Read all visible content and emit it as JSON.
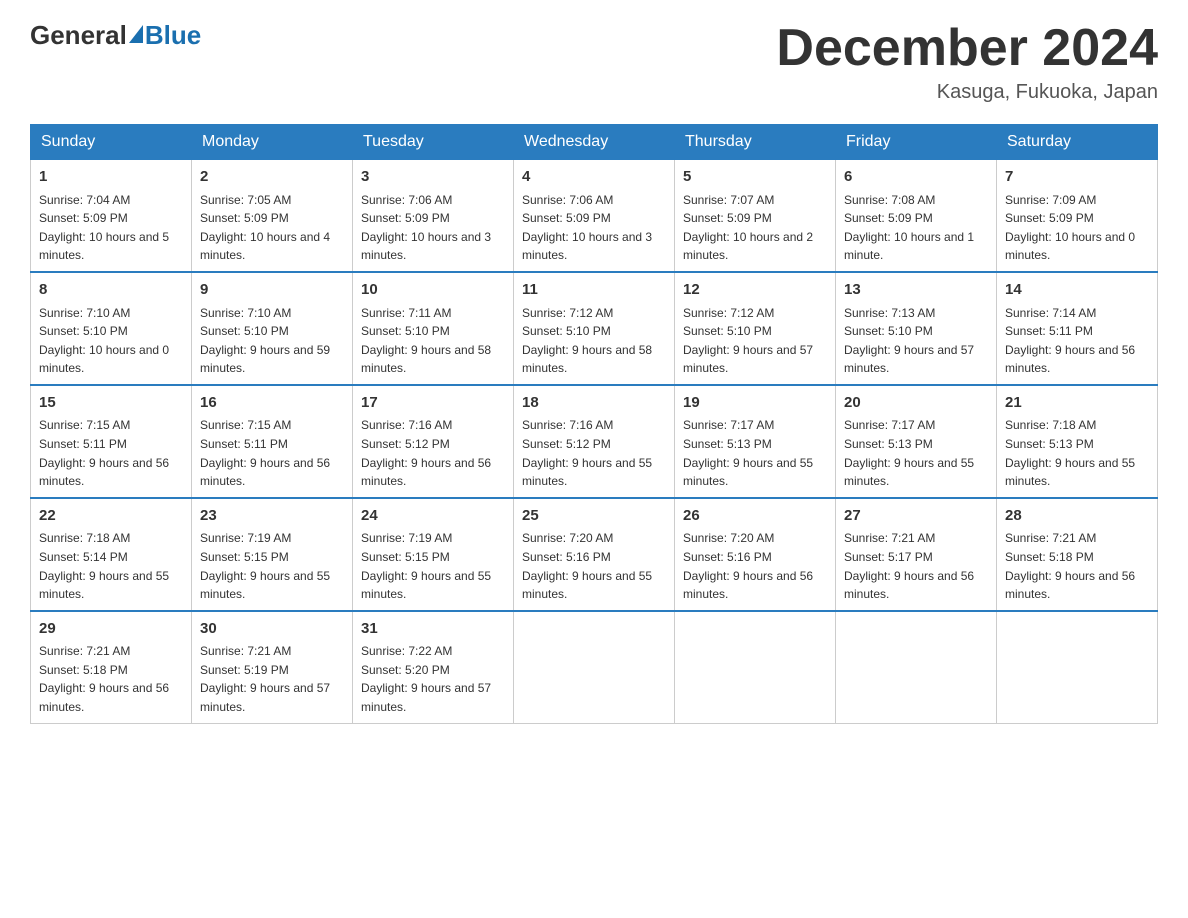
{
  "header": {
    "logo_general": "General",
    "logo_blue": "Blue",
    "month_title": "December 2024",
    "location": "Kasuga, Fukuoka, Japan"
  },
  "days_of_week": [
    "Sunday",
    "Monday",
    "Tuesday",
    "Wednesday",
    "Thursday",
    "Friday",
    "Saturday"
  ],
  "weeks": [
    [
      {
        "day": "1",
        "sunrise": "7:04 AM",
        "sunset": "5:09 PM",
        "daylight": "10 hours and 5 minutes."
      },
      {
        "day": "2",
        "sunrise": "7:05 AM",
        "sunset": "5:09 PM",
        "daylight": "10 hours and 4 minutes."
      },
      {
        "day": "3",
        "sunrise": "7:06 AM",
        "sunset": "5:09 PM",
        "daylight": "10 hours and 3 minutes."
      },
      {
        "day": "4",
        "sunrise": "7:06 AM",
        "sunset": "5:09 PM",
        "daylight": "10 hours and 3 minutes."
      },
      {
        "day": "5",
        "sunrise": "7:07 AM",
        "sunset": "5:09 PM",
        "daylight": "10 hours and 2 minutes."
      },
      {
        "day": "6",
        "sunrise": "7:08 AM",
        "sunset": "5:09 PM",
        "daylight": "10 hours and 1 minute."
      },
      {
        "day": "7",
        "sunrise": "7:09 AM",
        "sunset": "5:09 PM",
        "daylight": "10 hours and 0 minutes."
      }
    ],
    [
      {
        "day": "8",
        "sunrise": "7:10 AM",
        "sunset": "5:10 PM",
        "daylight": "10 hours and 0 minutes."
      },
      {
        "day": "9",
        "sunrise": "7:10 AM",
        "sunset": "5:10 PM",
        "daylight": "9 hours and 59 minutes."
      },
      {
        "day": "10",
        "sunrise": "7:11 AM",
        "sunset": "5:10 PM",
        "daylight": "9 hours and 58 minutes."
      },
      {
        "day": "11",
        "sunrise": "7:12 AM",
        "sunset": "5:10 PM",
        "daylight": "9 hours and 58 minutes."
      },
      {
        "day": "12",
        "sunrise": "7:12 AM",
        "sunset": "5:10 PM",
        "daylight": "9 hours and 57 minutes."
      },
      {
        "day": "13",
        "sunrise": "7:13 AM",
        "sunset": "5:10 PM",
        "daylight": "9 hours and 57 minutes."
      },
      {
        "day": "14",
        "sunrise": "7:14 AM",
        "sunset": "5:11 PM",
        "daylight": "9 hours and 56 minutes."
      }
    ],
    [
      {
        "day": "15",
        "sunrise": "7:15 AM",
        "sunset": "5:11 PM",
        "daylight": "9 hours and 56 minutes."
      },
      {
        "day": "16",
        "sunrise": "7:15 AM",
        "sunset": "5:11 PM",
        "daylight": "9 hours and 56 minutes."
      },
      {
        "day": "17",
        "sunrise": "7:16 AM",
        "sunset": "5:12 PM",
        "daylight": "9 hours and 56 minutes."
      },
      {
        "day": "18",
        "sunrise": "7:16 AM",
        "sunset": "5:12 PM",
        "daylight": "9 hours and 55 minutes."
      },
      {
        "day": "19",
        "sunrise": "7:17 AM",
        "sunset": "5:13 PM",
        "daylight": "9 hours and 55 minutes."
      },
      {
        "day": "20",
        "sunrise": "7:17 AM",
        "sunset": "5:13 PM",
        "daylight": "9 hours and 55 minutes."
      },
      {
        "day": "21",
        "sunrise": "7:18 AM",
        "sunset": "5:13 PM",
        "daylight": "9 hours and 55 minutes."
      }
    ],
    [
      {
        "day": "22",
        "sunrise": "7:18 AM",
        "sunset": "5:14 PM",
        "daylight": "9 hours and 55 minutes."
      },
      {
        "day": "23",
        "sunrise": "7:19 AM",
        "sunset": "5:15 PM",
        "daylight": "9 hours and 55 minutes."
      },
      {
        "day": "24",
        "sunrise": "7:19 AM",
        "sunset": "5:15 PM",
        "daylight": "9 hours and 55 minutes."
      },
      {
        "day": "25",
        "sunrise": "7:20 AM",
        "sunset": "5:16 PM",
        "daylight": "9 hours and 55 minutes."
      },
      {
        "day": "26",
        "sunrise": "7:20 AM",
        "sunset": "5:16 PM",
        "daylight": "9 hours and 56 minutes."
      },
      {
        "day": "27",
        "sunrise": "7:21 AM",
        "sunset": "5:17 PM",
        "daylight": "9 hours and 56 minutes."
      },
      {
        "day": "28",
        "sunrise": "7:21 AM",
        "sunset": "5:18 PM",
        "daylight": "9 hours and 56 minutes."
      }
    ],
    [
      {
        "day": "29",
        "sunrise": "7:21 AM",
        "sunset": "5:18 PM",
        "daylight": "9 hours and 56 minutes."
      },
      {
        "day": "30",
        "sunrise": "7:21 AM",
        "sunset": "5:19 PM",
        "daylight": "9 hours and 57 minutes."
      },
      {
        "day": "31",
        "sunrise": "7:22 AM",
        "sunset": "5:20 PM",
        "daylight": "9 hours and 57 minutes."
      },
      null,
      null,
      null,
      null
    ]
  ],
  "labels": {
    "sunrise": "Sunrise:",
    "sunset": "Sunset:",
    "daylight": "Daylight:"
  }
}
